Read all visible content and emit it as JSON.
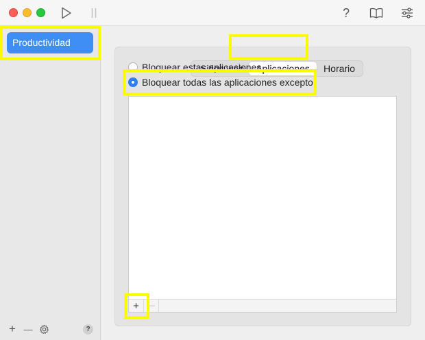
{
  "window": {
    "toolbar": {
      "icons": [
        "play-icon",
        "pause-icon",
        "help-icon",
        "book-icon",
        "sliders-icon"
      ],
      "help_label": "?"
    }
  },
  "sidebar": {
    "items": [
      {
        "label": "Productividad",
        "selected": true
      }
    ],
    "bottom": {
      "add_label": "+",
      "remove_label": "—",
      "settings_icon": "gear-icon",
      "help_label": "?"
    }
  },
  "main": {
    "tabs": [
      {
        "label": "Sitios web",
        "selected": false
      },
      {
        "label": "Aplicaciones",
        "selected": true
      },
      {
        "label": "Horario",
        "selected": false
      }
    ],
    "options": [
      {
        "label": "Bloquear estas aplicaciones",
        "checked": false
      },
      {
        "label": "Bloquear todas las aplicaciones excepto",
        "checked": true
      }
    ],
    "list": {
      "add_label": "+",
      "remove_label": "—"
    }
  },
  "colors": {
    "accent": "#3f8ef5",
    "highlight": "#fbfb00"
  }
}
